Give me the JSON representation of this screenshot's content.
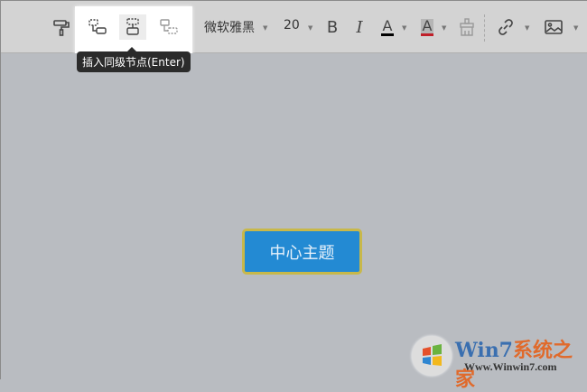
{
  "toolbar": {
    "font_family": "微软雅黑",
    "font_size": "20",
    "tooltip": "插入同级节点(Enter)",
    "colors": {
      "font_underline": "#000000",
      "highlight_underline": "#c0202a"
    }
  },
  "canvas": {
    "central_topic": "中心主题"
  },
  "watermark": {
    "title_a": "Wi",
    "title_b": "n7",
    "title_c": "系统之家",
    "url": "Www.Winwin7.com"
  }
}
